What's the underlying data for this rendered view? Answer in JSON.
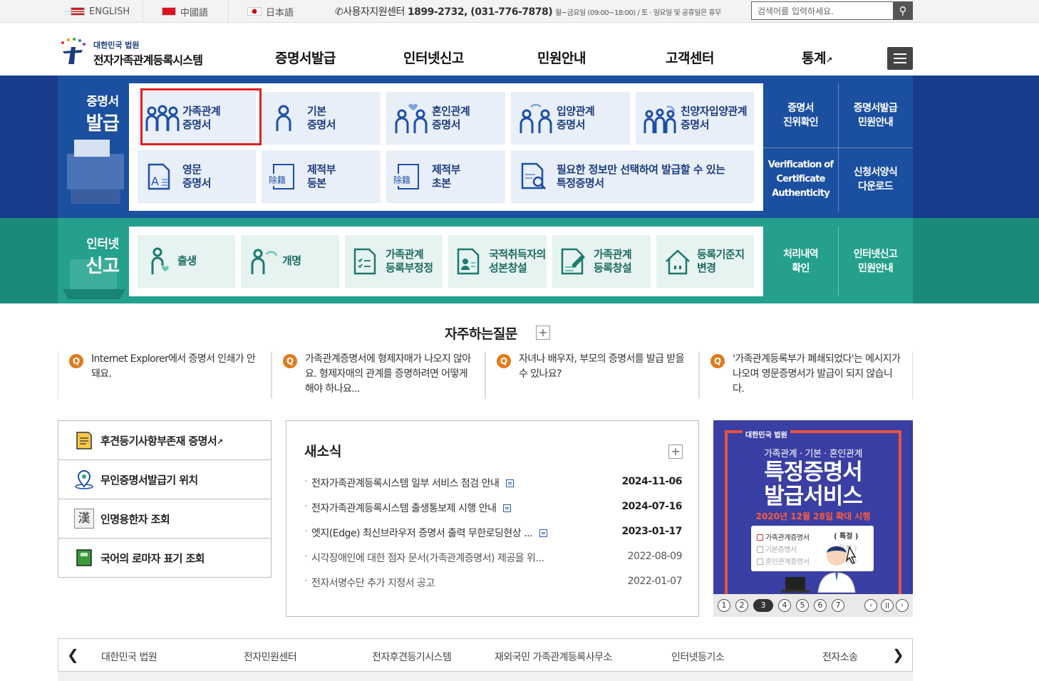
{
  "topbar": {
    "langs": [
      "ENGLISH",
      "中國語",
      "日本語"
    ],
    "support_prefix": "사용자지원센터",
    "support_numbers": "1899-2732, (031-776-7878)",
    "support_hours": "월~금요일 (09:00~18:00) / 토 · 일요일 및 공휴일은 휴무",
    "search_placeholder": "검색어를 입력하세요."
  },
  "header": {
    "logo_small": "대한민국 법원",
    "logo_title": "전자가족관계등록시스템",
    "nav": [
      "증명서발급",
      "인터넷신고",
      "민원안내",
      "고객센터",
      "통계"
    ]
  },
  "cert": {
    "title1": "증명서",
    "title2": "발급",
    "cards": [
      {
        "l1": "가족관계",
        "l2": "증명서"
      },
      {
        "l1": "기본",
        "l2": "증명서"
      },
      {
        "l1": "혼인관계",
        "l2": "증명서"
      },
      {
        "l1": "입양관계",
        "l2": "증명서"
      },
      {
        "l1": "친양자입양관계",
        "l2": "증명서"
      },
      {
        "l1": "영문",
        "l2": "증명서"
      },
      {
        "l1": "제적부",
        "l2": "등본"
      },
      {
        "l1": "제적부",
        "l2": "초본"
      },
      {
        "l1": "필요한 정보만 선택하여 발급할 수 있는",
        "l2": "특정증명서"
      }
    ],
    "side": [
      {
        "l1": "증명서",
        "l2": "진위확인"
      },
      {
        "l1": "증명서발급",
        "l2": "민원안내"
      },
      {
        "l1": "Verification of",
        "l2": "Certificate",
        "l3": "Authenticity"
      },
      {
        "l1": "신청서양식",
        "l2": "다운로드"
      }
    ],
    "icon_text": [
      "除籍",
      "除籍"
    ]
  },
  "report": {
    "title1": "인터넷",
    "title2": "신고",
    "cards": [
      {
        "l1": "출생",
        "l2": ""
      },
      {
        "l1": "개명",
        "l2": ""
      },
      {
        "l1": "가족관계",
        "l2": "등록부정정"
      },
      {
        "l1": "국적취득자의",
        "l2": "성본창설"
      },
      {
        "l1": "가족관계",
        "l2": "등록창설"
      },
      {
        "l1": "등록기준지",
        "l2": "변경"
      }
    ],
    "side": [
      {
        "l1": "처리내역",
        "l2": "확인"
      },
      {
        "l1": "인터넷신고",
        "l2": "민원안내"
      }
    ]
  },
  "faq": {
    "title": "자주하는질문",
    "q_mark": "Q",
    "items": [
      "Internet Explorer에서 증명서 인쇄가 안돼요.",
      "가족관계증명서에 형제자매가 나오지 않아요. 형제자매의 관계를 증명하려면 어떻게 해야 하나요...",
      "자녀나 배우자, 부모의 증명서를 발급 받을 수 있나요?",
      "'가족관계등록부가 폐쇄되었다'는 메시지가 나오며 영문증명서가 발급이 되지 않습니다."
    ]
  },
  "quick": [
    "후견등기사항부존재 증명서",
    "무인증명서발급기 위치",
    "인명용한자 조회",
    "국어의 로마자 표기 조회"
  ],
  "quick_icon_text": "漢",
  "news": {
    "title": "새소식",
    "items": [
      {
        "t": "전자가족관계등록시스템 일부 서비스 점검 안내",
        "d": "2024-11-06",
        "new": true
      },
      {
        "t": "전자가족관계등록시스템 출생통보제 시행 안내",
        "d": "2024-07-16",
        "new": true
      },
      {
        "t": "엣지(Edge) 최신브라우저 증명서 출력 무한로딩현상 ...",
        "d": "2023-01-17",
        "new": true
      },
      {
        "t": "시각장애인에 대한 점자 문서(가족관계증명서) 제공을 위...",
        "d": "2022-08-09",
        "new": false
      },
      {
        "t": "전자서명수단 추가 지정서 공고",
        "d": "2022-01-07",
        "new": false
      }
    ]
  },
  "banner": {
    "head": "대한민국 법원",
    "sub": "가족관계 · 기본 · 혼인관계",
    "big1": "특정증명서",
    "big2": "발급서비스",
    "date": "2020년 12월 28일 확대 시행",
    "rows": [
      "가족관계증명서",
      "기본증명서",
      "혼인관계증명서"
    ],
    "tags": [
      "( 특정 )",
      "( 특정 )",
      "( 특정 )"
    ],
    "pages": [
      "1",
      "2",
      "3",
      "4",
      "5",
      "6",
      "7"
    ],
    "active_page": 3
  },
  "links": [
    "대한민국 법원",
    "전자민원센터",
    "전자후견등기시스템",
    "재외국민 가족관계등록사무소",
    "인터넷등기소",
    "전자소송"
  ],
  "colors": {
    "cert_bg": "#1b4f9f",
    "report_bg": "#24a08c",
    "highlight": "#e02020",
    "accent": "#e9543c"
  }
}
